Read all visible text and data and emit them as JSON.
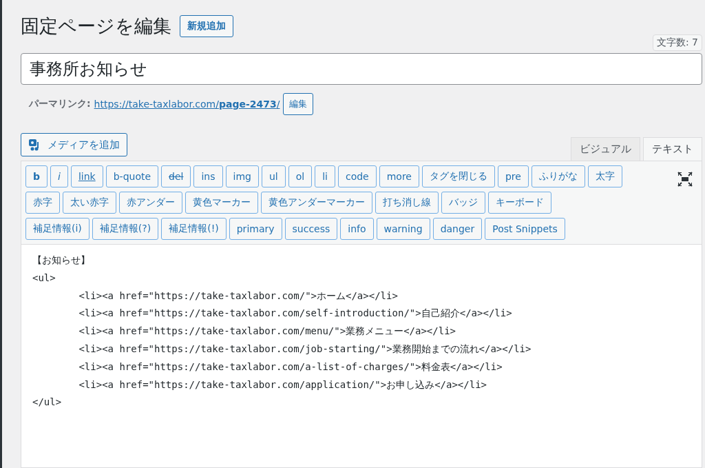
{
  "heading": {
    "title": "固定ページを編集",
    "add_new": "新規追加"
  },
  "word_count": "文字数: 7",
  "post_title": {
    "value": "事務所お知らせ"
  },
  "permalink": {
    "label": "パーマリンク:",
    "url_prefix": "https://take-taxlabor.com/",
    "url_slug": "page-2473",
    "url_suffix": "/",
    "edit": "編集"
  },
  "add_media": "メディアを追加",
  "tabs": [
    {
      "label": "ビジュアル",
      "selected": false
    },
    {
      "label": "テキスト",
      "selected": true
    }
  ],
  "toolbar": [
    [
      {
        "label": "b",
        "kind": "bold"
      },
      {
        "label": "i",
        "kind": "italic"
      },
      {
        "label": "link",
        "kind": "underline"
      },
      {
        "label": "b-quote",
        "kind": "plain"
      },
      {
        "label": "del",
        "kind": "strike"
      },
      {
        "label": "ins",
        "kind": "plain"
      },
      {
        "label": "img",
        "kind": "plain"
      },
      {
        "label": "ul",
        "kind": "plain"
      },
      {
        "label": "ol",
        "kind": "plain"
      },
      {
        "label": "li",
        "kind": "plain"
      },
      {
        "label": "code",
        "kind": "plain"
      },
      {
        "label": "more",
        "kind": "plain"
      },
      {
        "label": "タグを閉じる",
        "kind": "plain"
      },
      {
        "label": "pre",
        "kind": "plain"
      },
      {
        "label": "ふりがな",
        "kind": "plain"
      },
      {
        "label": "太字",
        "kind": "plain"
      }
    ],
    [
      {
        "label": "赤字",
        "kind": "plain"
      },
      {
        "label": "太い赤字",
        "kind": "plain"
      },
      {
        "label": "赤アンダー",
        "kind": "plain"
      },
      {
        "label": "黄色マーカー",
        "kind": "plain"
      },
      {
        "label": "黄色アンダーマーカー",
        "kind": "plain"
      },
      {
        "label": "打ち消し線",
        "kind": "plain"
      },
      {
        "label": "バッジ",
        "kind": "plain"
      },
      {
        "label": "キーボード",
        "kind": "plain"
      }
    ],
    [
      {
        "label": "補足情報(i)",
        "kind": "plain"
      },
      {
        "label": "補足情報(?)",
        "kind": "plain"
      },
      {
        "label": "補足情報(!)",
        "kind": "plain"
      },
      {
        "label": "primary",
        "kind": "plain"
      },
      {
        "label": "success",
        "kind": "plain"
      },
      {
        "label": "info",
        "kind": "plain"
      },
      {
        "label": "warning",
        "kind": "plain"
      },
      {
        "label": "danger",
        "kind": "plain"
      },
      {
        "label": "Post Snippets",
        "kind": "plain"
      }
    ]
  ],
  "editor": {
    "value": "【お知らせ】\n<ul>\n\t<li><a href=\"https://take-taxlabor.com/\">ホーム</a></li>\n\t<li><a href=\"https://take-taxlabor.com/self-introduction/\">自己紹介</a></li>\n\t<li><a href=\"https://take-taxlabor.com/menu/\">業務メニュー</a></li>\n\t<li><a href=\"https://take-taxlabor.com/job-starting/\">業務開始までの流れ</a></li>\n\t<li><a href=\"https://take-taxlabor.com/a-list-of-charges/\">料金表</a></li>\n\t<li><a href=\"https://take-taxlabor.com/application/\">お申し込み</a></li>\n</ul>"
  }
}
